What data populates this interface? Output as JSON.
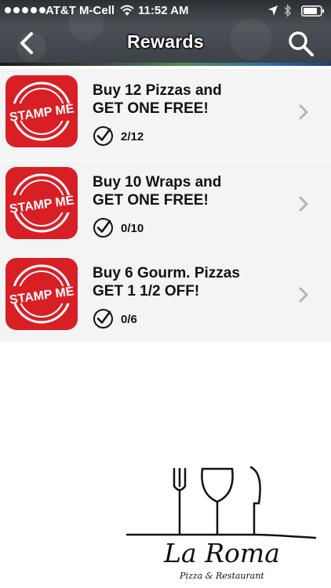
{
  "status_bar": {
    "carrier": "AT&T M-Cell",
    "time": "11:52 AM"
  },
  "nav": {
    "title": "Rewards"
  },
  "rewards": [
    {
      "line1": "Buy 12 Pizzas and",
      "line2": "GET ONE FREE!",
      "progress": "2/12"
    },
    {
      "line1": "Buy 10 Wraps and",
      "line2": "GET ONE FREE!",
      "progress": "0/10"
    },
    {
      "line1": "Buy 6 Gourm. Pizzas",
      "line2": "GET 1 1/2 OFF!",
      "progress": "0/6"
    }
  ],
  "stamp_label": "STAMP ME",
  "logo": {
    "name": "La Roma",
    "subtitle": "Pizza & Restaurant"
  },
  "colors": {
    "stamp_red": "#d81f26",
    "row_background": "#f4f4f4",
    "header_dark": "#3c4146"
  }
}
